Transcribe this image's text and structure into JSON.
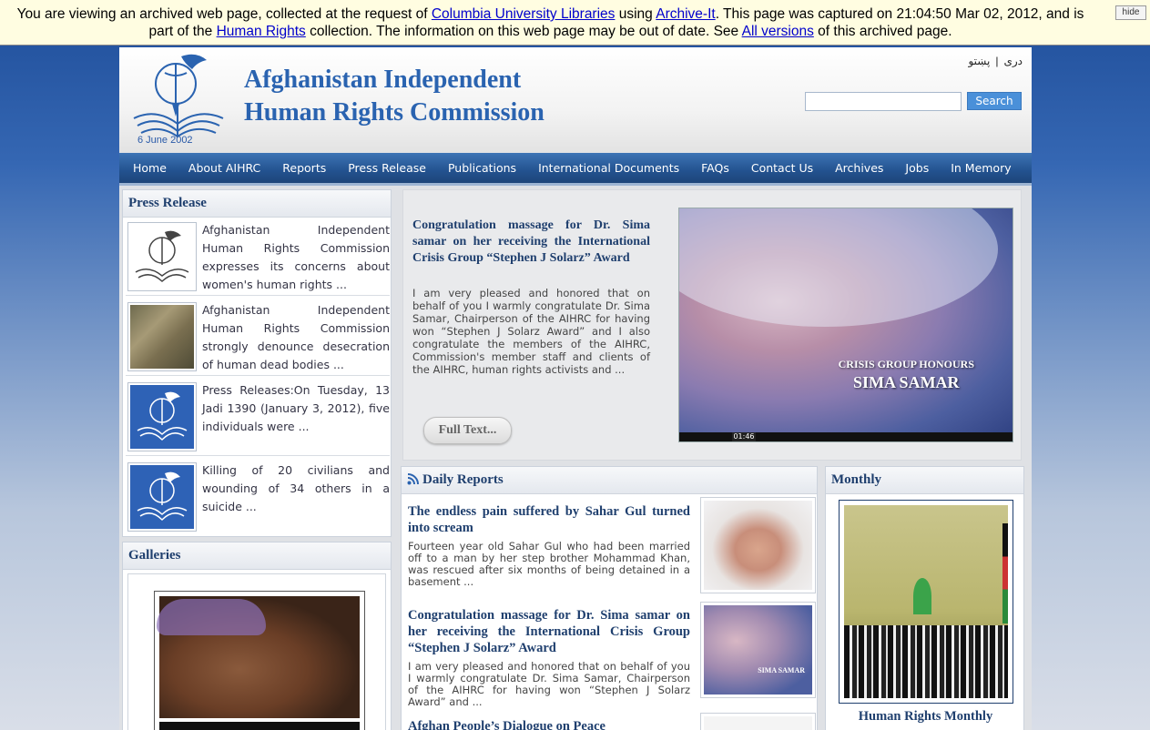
{
  "archive_banner": {
    "t1": "You are viewing an archived web page, collected at the request of ",
    "l1": "Columbia University Libraries",
    "t2": " using ",
    "l2": "Archive-It",
    "t3": ". This page was captured on 21:04:50 Mar 02, 2012, and is part of the ",
    "l3": "Human Rights",
    "t4": " collection. The information on this web page may be out of date. See ",
    "l4": "All versions",
    "t5": " of this archived page.",
    "hide_label": "hide"
  },
  "header": {
    "title_line1": "Afghanistan Independent",
    "title_line2": "Human Rights Commission",
    "logo_date": "6 June  2002",
    "lang_pashto": "پښتو",
    "lang_separator": "|",
    "lang_dari": "دری",
    "search_placeholder": "",
    "search_button": "Search"
  },
  "nav": {
    "items": [
      "Home",
      "About AIHRC",
      "Reports",
      "Press Release",
      "Publications",
      "International Documents",
      "FAQs",
      "Contact Us",
      "Archives",
      "Jobs",
      "In Memory"
    ]
  },
  "press_release": {
    "heading": "Press Release",
    "items": [
      {
        "text": "Afghanistan Independent Human Rights Commission expresses its concerns about women's human rights ..."
      },
      {
        "text": "Afghanistan Independent Human Rights Commission strongly denounce desecration of human dead bodies ..."
      },
      {
        "text": "Press Releases:On Tuesday, 13 Jadi 1390 (January 3, 2012), five individuals were ..."
      },
      {
        "text": "Killing of 20 civilians and wounding of 34 others in a suicide ..."
      }
    ]
  },
  "galleries": {
    "heading": "Galleries"
  },
  "feature": {
    "title": "Congratulation massage for Dr. Sima samar on her receiving the International Crisis Group “Stephen J Solarz” Award",
    "body": "I am very pleased and honored that on behalf of you I warmly congratulate Dr. Sima Samar, Chairperson of the AIHRC for having won “Stephen J Solarz Award” and I also congratulate the members of the AIHRC, Commission's member staff and clients of the AIHRC, human rights activists and ...",
    "full_text_button": "Full Text...",
    "video_caption_line1": "CRISIS GROUP HONOURS",
    "video_caption_line2": "SIMA SAMAR",
    "video_time": "01:46"
  },
  "daily_reports": {
    "heading": "Daily Reports",
    "items": [
      {
        "title": "The endless pain suffered by Sahar Gul turned into scream",
        "body": "Fourteen year old Sahar Gul who had been married off to a man by her step brother Mohammad Khan, was rescued after six months of being detained in a basement ..."
      },
      {
        "title": "Congratulation massage for Dr. Sima samar on her receiving the International Crisis Group “Stephen J Solarz” Award",
        "body": "I am very pleased and honored that on behalf of you I warmly congratulate Dr. Sima Samar, Chairperson of the AIHRC for having won “Stephen J Solarz Award” and ...",
        "thumb_caption": "SIMA SAMAR"
      },
      {
        "title": "Afghan People’s Dialogue on Peace"
      }
    ]
  },
  "monthly": {
    "heading": "Monthly",
    "caption": "Human Rights Monthly"
  },
  "colors": {
    "brand_blue": "#2a63b0",
    "nav_blue": "#23528f",
    "heading_navy": "#1f3f6e",
    "search_button": "#4a90d9"
  }
}
